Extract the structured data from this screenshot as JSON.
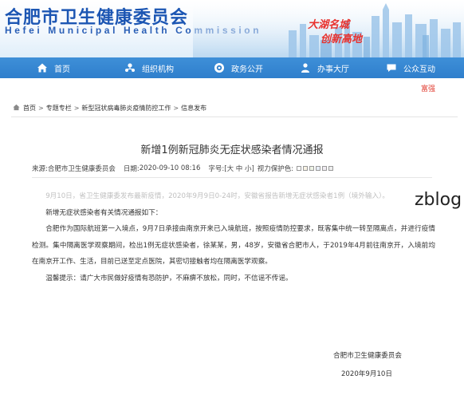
{
  "header": {
    "site_name_cn": "合肥市卫生健康委员会",
    "site_name_en": "Hefei Municipal Health Commission",
    "slogan_line1": "大湖名城",
    "slogan_line2": "创新高地"
  },
  "nav": {
    "items": [
      {
        "label": "首页",
        "icon": "home-icon"
      },
      {
        "label": "组织机构",
        "icon": "org-icon"
      },
      {
        "label": "政务公开",
        "icon": "gov-icon"
      },
      {
        "label": "办事大厅",
        "icon": "hall-icon"
      },
      {
        "label": "公众互动",
        "icon": "chat-icon"
      }
    ]
  },
  "ticker": "富强",
  "breadcrumb": {
    "items": [
      "首页",
      "专题专栏",
      "新型冠状病毒肺炎疫情防控工作",
      "信息发布"
    ],
    "separator": ">"
  },
  "article": {
    "title": "新增1例新冠肺炎无症状感染者情况通报",
    "source_label": "来源:",
    "source": "合肥市卫生健康委员会",
    "date_label": "日期:",
    "date": "2020-09-10 08:16",
    "font_label": "字号:",
    "font_sizes": "[大 中 小]",
    "protect_label": "视力保护色:",
    "paragraphs": [
      "9月10日，省卫生健康委发布最新疫情，2020年9月9日0-24时，安徽省报告新增无症状感染者1例（境外输入）。",
      "新增无症状感染者有关情况通报如下：",
      "合肥作为国际航班第一入境点，9月7日承接由南京开来已入境航班，按照疫情防控要求，既客集中统一转至隔离点，并进行疫情检测。集中隔离医学观察期间，检出1例无症状感染者，徐某某，男，48岁，安徽省合肥市人，于2019年4月前往南京开，入境前均在南京开工作、生活，目前已送至定点医院，其密切接触者均在隔离医学观察。",
      "温馨提示：请广大市民做好疫情有恐防护，不麻痹不放松，同时，不信谣不传谣。"
    ],
    "signature": "合肥市卫生健康委员会",
    "sign_date": "2020年9月10日"
  },
  "watermark": "zblog",
  "colors": {
    "nav_bg": "#2f7fcc",
    "brand_blue": "#1c56b3",
    "slogan_red": "#e8322e",
    "ticker_red": "#e03a2e"
  }
}
